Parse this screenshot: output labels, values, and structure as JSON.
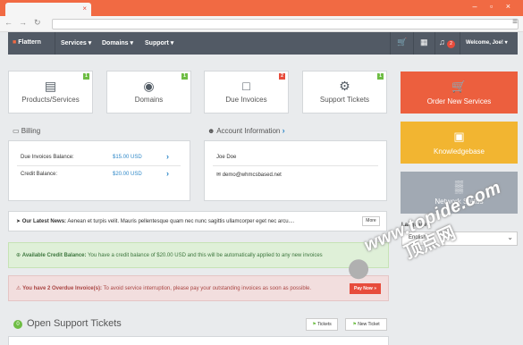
{
  "browser": {
    "close_glyph": "×",
    "window_controls": "– ▫ ×",
    "back_icon": "back-arrow-icon",
    "menu_glyph": "≡"
  },
  "navbar": {
    "brand": "Flattern",
    "items": [
      "Services ▾",
      "Domains ▾",
      "Support ▾"
    ],
    "notification_count": "2",
    "welcome": "Welcome, Joe! ▾"
  },
  "tiles": [
    {
      "label": "Products/Services",
      "count": "1",
      "count_color": "#6ebd44",
      "icon": "hdd-icon"
    },
    {
      "label": "Domains",
      "count": "1",
      "count_color": "#6ebd44",
      "icon": "globe-icon"
    },
    {
      "label": "Due Invoices",
      "count": "2",
      "count_color": "#e74c3c",
      "icon": "document-icon"
    },
    {
      "label": "Support Tickets",
      "count": "1",
      "count_color": "#6ebd44",
      "icon": "gear-icon"
    }
  ],
  "billing": {
    "title": "Billing",
    "rows": [
      {
        "label": "Due Invoices Balance:",
        "value": "$15.00 USD"
      },
      {
        "label": "Credit Balance:",
        "value": "$20.00 USD"
      }
    ]
  },
  "account": {
    "title": "Account Information",
    "name": "Joe Doe",
    "email": "demo@whmcsbased.net"
  },
  "news": {
    "label": "Our Latest News:",
    "text": "Aenean et turpis velit. Mauris pellentesque quam nec nunc sagittis ullamcorper eget nec arcu....",
    "more": "More"
  },
  "credit_alert": {
    "label": "Available Credit Balance:",
    "text": "You have a credit balance of $20.00 USD and this will be automatically applied to any new invoices"
  },
  "overdue_alert": {
    "label": "You have 2 Overdue Invoice(s):",
    "text": "To avoid service interruption, please pay your outstanding invoices as soon as possible.",
    "button": "Pay Now »"
  },
  "support": {
    "count": "0",
    "title": "Open Support Tickets",
    "tickets_button": "Tickets",
    "new_ticket_button": "New Ticket"
  },
  "sidebar": {
    "tiles": [
      {
        "label": "Order New Services",
        "color": "#ec5f3e",
        "icon": "cart-icon"
      },
      {
        "label": "Knowledgebase",
        "color": "#f2b531",
        "icon": "book-icon"
      },
      {
        "label": "Network Status",
        "color": "#a1a9b3",
        "icon": "bar-chart-icon"
      }
    ],
    "language_label": "Language:",
    "language_value": "English"
  },
  "watermark": {
    "line1": "www.topide.com",
    "line2": "顶点网"
  }
}
